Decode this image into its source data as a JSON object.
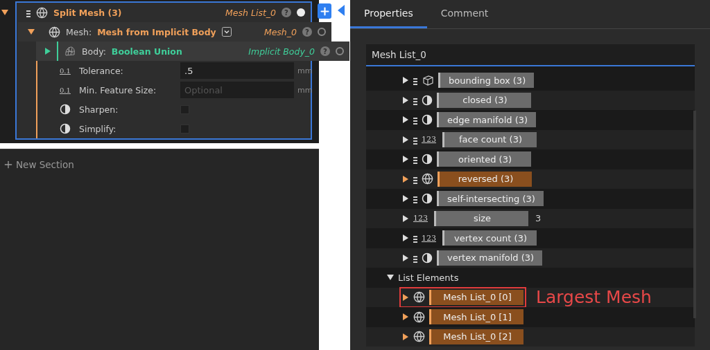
{
  "node": {
    "title": "Split Mesh (3)",
    "output": "Mesh List_0",
    "expanded": true,
    "help": "?",
    "selected": true,
    "input": {
      "label": "Mesh:",
      "value": "Mesh from Implicit Body",
      "output": "Mesh_0",
      "expanded": true,
      "help": "?",
      "body": {
        "label": "Body:",
        "value": "Boolean Union",
        "output": "Implicit Body_0",
        "expanded": false,
        "help": "?"
      },
      "params": [
        {
          "kind": "number",
          "icon_label": "0.1",
          "label": "Tolerance:",
          "value": ".5",
          "unit": "mm"
        },
        {
          "kind": "number",
          "icon_label": "0.1",
          "label": "Min. Feature Size:",
          "placeholder": "Optional",
          "unit": "mm"
        },
        {
          "kind": "toggle",
          "label": "Sharpen:",
          "checked": false
        },
        {
          "kind": "toggle",
          "label": "Simplify:",
          "checked": false
        }
      ]
    }
  },
  "new_section": {
    "label": "New Section"
  },
  "tabs": [
    {
      "label": "Properties",
      "selected": true
    },
    {
      "label": "Comment",
      "selected": false
    }
  ],
  "panel_title": "Mesh List_0",
  "properties": [
    {
      "kind": "box",
      "label": "bounding box (3)",
      "color": "#6b6b6b"
    },
    {
      "kind": "boolean",
      "label": "closed (3)",
      "color": "#6b6b6b"
    },
    {
      "kind": "boolean",
      "label": "edge manifold (3)",
      "color": "#6b6b6b"
    },
    {
      "kind": "counts",
      "icon_label": "123",
      "label": "face count (3)",
      "color": "#6b6b6b"
    },
    {
      "kind": "boolean",
      "label": "oriented (3)",
      "color": "#6b6b6b"
    },
    {
      "kind": "mesh",
      "label": "reversed (3)",
      "color": "#8a4f1e"
    },
    {
      "kind": "boolean",
      "label": "self-intersecting (3)",
      "color": "#6b6b6b"
    },
    {
      "kind": "integer",
      "icon_label": "123",
      "label": "size",
      "value": "3",
      "color": "#6b6b6b"
    },
    {
      "kind": "counts",
      "icon_label": "123",
      "label": "vertex count (3)",
      "color": "#6b6b6b"
    },
    {
      "kind": "boolean",
      "label": "vertex manifold (3)",
      "color": "#6b6b6b"
    }
  ],
  "list_elements": {
    "label": "List Elements",
    "expanded": true,
    "items": [
      {
        "label": "Mesh List_0 [0]",
        "highlighted": true,
        "note": "Largest Mesh"
      },
      {
        "label": "Mesh List_0 [1]",
        "highlighted": false
      },
      {
        "label": "Mesh List_0 [2]",
        "highlighted": false
      }
    ]
  }
}
